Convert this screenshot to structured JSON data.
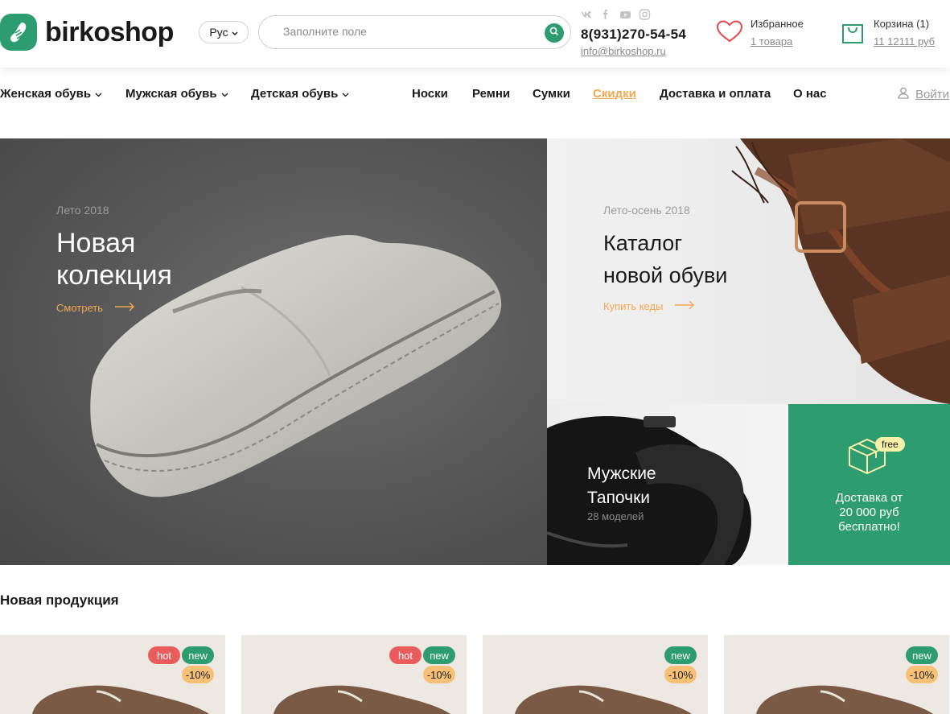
{
  "header": {
    "logo_text": "birkoshop",
    "language": "Рус",
    "search_placeholder": "Заполните поле",
    "phone": "8(931)270-54-54",
    "email": "info@birkoshop.ru",
    "favorites_title": "Избранное",
    "favorites_count": "1 товара",
    "cart_title": "Корзина (1)",
    "cart_total": "11 12111 руб",
    "social_icons": [
      "vk-icon",
      "facebook-icon",
      "youtube-icon",
      "instagram-icon"
    ]
  },
  "nav": {
    "items": [
      "Женская обувь",
      "Мужская обувь",
      "Детская обувь",
      "Носки",
      "Ремни",
      "Сумки",
      "Скидки",
      "Доставка и оплата",
      "О нас"
    ],
    "login": "Войти"
  },
  "hero": {
    "left_eyebrow": "Лето 2018",
    "left_title_1": "Новая",
    "left_title_2": "колекция",
    "left_link": "Смотреть",
    "right_eyebrow": "Лето-осень 2018",
    "right_title_1": "Каталог",
    "right_title_2": "новой обуви",
    "right_link": "Купить кеды"
  },
  "tiles": {
    "slippers_title_1": "Мужские",
    "slippers_title_2": "Тапочки",
    "slippers_count": "28 моделей",
    "free_badge": "free",
    "delivery_1": "Доставка от",
    "delivery_2": "20 000 руб",
    "delivery_3": "бесплатно!"
  },
  "products_section": {
    "title": "Новая продукция",
    "cards": [
      {
        "hot": "hot",
        "new": "new",
        "discount": "-10%"
      },
      {
        "hot": "hot",
        "new": "new",
        "discount": "-10%"
      },
      {
        "new": "new",
        "discount": "-10%"
      },
      {
        "new": "new",
        "discount": "-10%"
      }
    ]
  },
  "colors": {
    "brand_green": "#2d9c6e",
    "accent_orange": "#f2a850",
    "hot_red": "#ea5b5b"
  }
}
